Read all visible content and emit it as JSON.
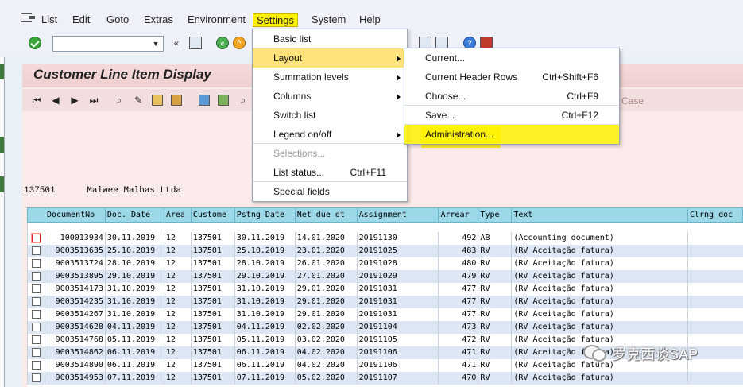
{
  "menubar": {
    "items": [
      "List",
      "Edit",
      "Goto",
      "Extras",
      "Environment",
      "Settings",
      "System",
      "Help"
    ]
  },
  "toolbar": {
    "command_value": ""
  },
  "page": {
    "title": "Customer Line Item Display",
    "case_label": "Case"
  },
  "customer": {
    "line": "137501      Malwee Malhas Ltda"
  },
  "table": {
    "columns": [
      "DocumentNo",
      "Doc. Date",
      "Area",
      "Custome",
      "Pstng Date",
      "Net due dt",
      "Assignment",
      "Arrear",
      "Type",
      "Text",
      "Clrng doc"
    ],
    "rows": [
      [
        "100013934",
        "30.11.2019",
        "12",
        "137501",
        "30.11.2019",
        "14.01.2020",
        "20191130",
        "492",
        "AB",
        "(Accounting document)",
        ""
      ],
      [
        "9003513635",
        "25.10.2019",
        "12",
        "137501",
        "25.10.2019",
        "23.01.2020",
        "20191025",
        "483",
        "RV",
        "(RV Aceitação fatura)",
        ""
      ],
      [
        "9003513724",
        "28.10.2019",
        "12",
        "137501",
        "28.10.2019",
        "26.01.2020",
        "20191028",
        "480",
        "RV",
        "(RV Aceitação fatura)",
        ""
      ],
      [
        "9003513895",
        "29.10.2019",
        "12",
        "137501",
        "29.10.2019",
        "27.01.2020",
        "20191029",
        "479",
        "RV",
        "(RV Aceitação fatura)",
        ""
      ],
      [
        "9003514173",
        "31.10.2019",
        "12",
        "137501",
        "31.10.2019",
        "29.01.2020",
        "20191031",
        "477",
        "RV",
        "(RV Aceitação fatura)",
        ""
      ],
      [
        "9003514235",
        "31.10.2019",
        "12",
        "137501",
        "31.10.2019",
        "29.01.2020",
        "20191031",
        "477",
        "RV",
        "(RV Aceitação fatura)",
        ""
      ],
      [
        "9003514267",
        "31.10.2019",
        "12",
        "137501",
        "31.10.2019",
        "29.01.2020",
        "20191031",
        "477",
        "RV",
        "(RV Aceitação fatura)",
        ""
      ],
      [
        "9003514628",
        "04.11.2019",
        "12",
        "137501",
        "04.11.2019",
        "02.02.2020",
        "20191104",
        "473",
        "RV",
        "(RV Aceitação fatura)",
        ""
      ],
      [
        "9003514768",
        "05.11.2019",
        "12",
        "137501",
        "05.11.2019",
        "03.02.2020",
        "20191105",
        "472",
        "RV",
        "(RV Aceitação fatura)",
        ""
      ],
      [
        "9003514862",
        "06.11.2019",
        "12",
        "137501",
        "06.11.2019",
        "04.02.2020",
        "20191106",
        "471",
        "RV",
        "(RV Aceitação fatura)",
        ""
      ],
      [
        "9003514890",
        "06.11.2019",
        "12",
        "137501",
        "06.11.2019",
        "04.02.2020",
        "20191106",
        "471",
        "RV",
        "(RV Aceitação fatura)",
        ""
      ],
      [
        "9003514953",
        "07.11.2019",
        "12",
        "137501",
        "07.11.2019",
        "05.02.2020",
        "20191107",
        "470",
        "RV",
        "(RV Aceitação fatura)",
        ""
      ]
    ]
  },
  "settings_menu": {
    "items": [
      {
        "label": "Basic list",
        "shortcut": "",
        "submenu": false,
        "disabled": false
      },
      {
        "label": "Layout",
        "shortcut": "",
        "submenu": true,
        "disabled": false
      },
      {
        "label": "Summation levels",
        "shortcut": "",
        "submenu": true,
        "disabled": false
      },
      {
        "label": "Columns",
        "shortcut": "",
        "submenu": true,
        "disabled": false
      },
      {
        "label": "Switch list",
        "shortcut": "",
        "submenu": false,
        "disabled": false
      },
      {
        "label": "Legend on/off",
        "shortcut": "",
        "submenu": true,
        "disabled": false
      },
      {
        "label": "Selections...",
        "shortcut": "",
        "submenu": false,
        "disabled": true
      },
      {
        "label": "List status...",
        "shortcut": "Ctrl+F11",
        "submenu": false,
        "disabled": false
      },
      {
        "label": "Special fields",
        "shortcut": "",
        "submenu": false,
        "disabled": false
      }
    ]
  },
  "layout_submenu": {
    "items": [
      {
        "label": "Current...",
        "shortcut": ""
      },
      {
        "label": "Current Header Rows",
        "shortcut": "Ctrl+Shift+F6"
      },
      {
        "label": "Choose...",
        "shortcut": "Ctrl+F9"
      },
      {
        "label": "Save...",
        "shortcut": "Ctrl+F12"
      },
      {
        "label": "Administration...",
        "shortcut": ""
      }
    ]
  },
  "watermark": {
    "text": "罗克西谈SAP"
  },
  "colors": {
    "header_bg": "#9dd8e8",
    "highlight": "#fff200",
    "menu_hl": "#ffe27a",
    "content_bg": "#fbeaea"
  }
}
